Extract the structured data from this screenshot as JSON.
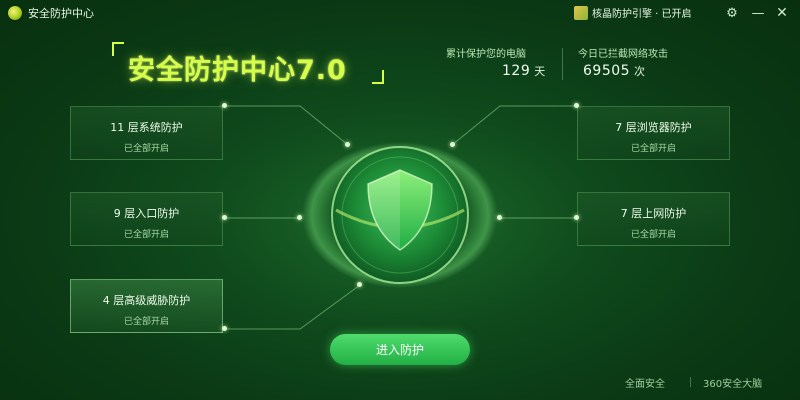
{
  "window": {
    "title": "安全防护中心",
    "engine_label": "核晶防护引擎 · 已开启"
  },
  "header": {
    "title": "安全防护中心7.0",
    "stats": [
      {
        "label": "累计保护您的电脑",
        "value": "129",
        "unit": "天"
      },
      {
        "label": "今日已拦截网络攻击",
        "value": "69505",
        "unit": "次"
      }
    ]
  },
  "left_cards": [
    {
      "name": "11 层系统防护",
      "status": "已全部开启"
    },
    {
      "name": "9 层入口防护",
      "status": "已全部开启"
    },
    {
      "name": "4 层高级威胁防护",
      "status": "已全部开启"
    }
  ],
  "right_cards": [
    {
      "name": "7 层浏览器防护",
      "status": "已全部开启"
    },
    {
      "name": "7 层上网防护",
      "status": "已全部开启"
    }
  ],
  "main_button": "进入防护",
  "footer": {
    "link1": "全面安全",
    "link2": "360安全大脑"
  },
  "colors": {
    "accent": "#d6ff4a",
    "button": "#2fc354",
    "background": "#0f4a1c"
  },
  "icons": [
    "app-logo-icon",
    "engine-cube-icon",
    "settings-icon",
    "minimize-icon",
    "close-icon",
    "shield-icon"
  ]
}
